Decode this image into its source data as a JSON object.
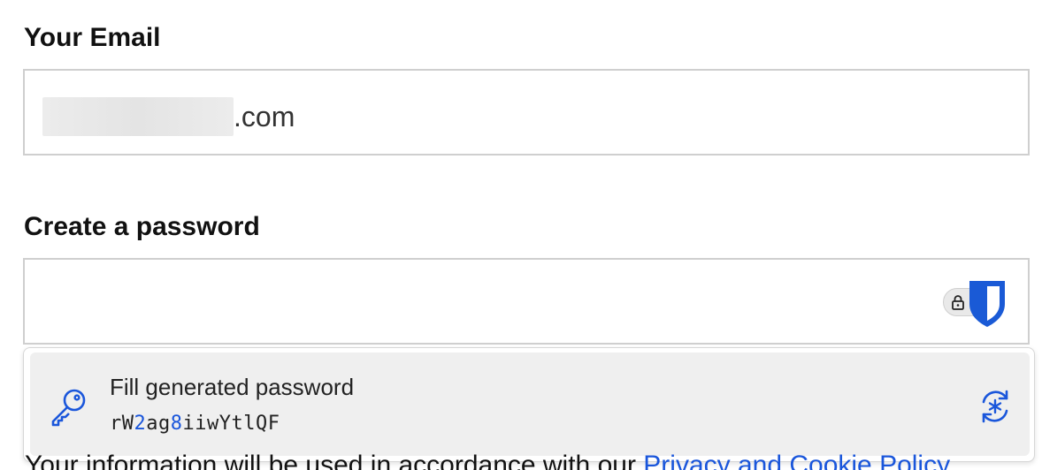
{
  "email_section": {
    "label": "Your Email",
    "value_suffix": ".com"
  },
  "password_section": {
    "label": "Create a password",
    "value": ""
  },
  "autofill_menu": {
    "item_title": "Fill generated password",
    "password_parts": [
      {
        "text": "rW",
        "type": "letter"
      },
      {
        "text": "2",
        "type": "number"
      },
      {
        "text": "ag",
        "type": "letter"
      },
      {
        "text": "8",
        "type": "number"
      },
      {
        "text": "iiwYtlQF",
        "type": "letter"
      }
    ],
    "icons": {
      "leading": "key-icon",
      "trailing": "regenerate-password-icon"
    }
  },
  "footer": {
    "text_before_link": "Your information will be used in accordance with our ",
    "link_text": "Privacy and Cookie Policy"
  },
  "colors": {
    "accent": "#1a56db",
    "field_border": "#cfcfcf",
    "menu_item_bg": "#efefef"
  }
}
